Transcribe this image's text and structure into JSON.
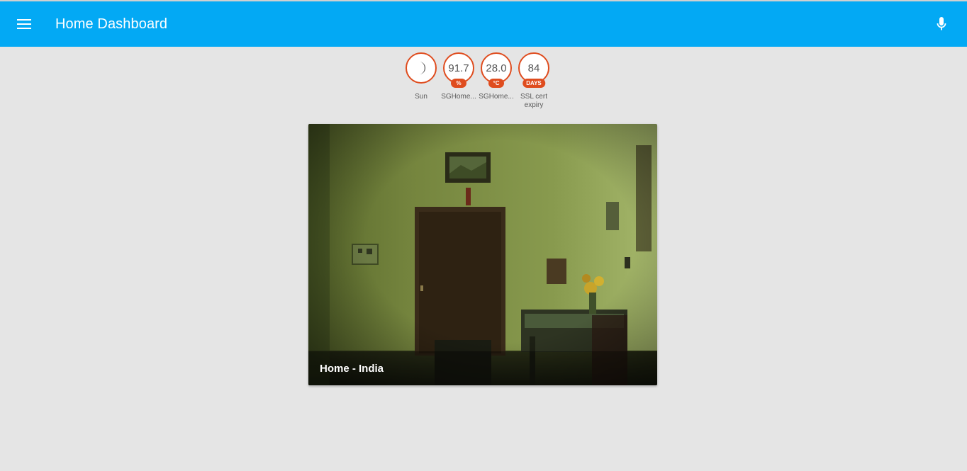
{
  "appbar": {
    "title": "Home Dashboard",
    "background": "#03a9f4",
    "menu_icon": "menu-icon",
    "mic_icon": "microphone-icon"
  },
  "badges": [
    {
      "name": "sun",
      "value": "",
      "icon": "moon-icon",
      "unit": "",
      "label": "Sun"
    },
    {
      "name": "humidity",
      "value": "91.7",
      "unit": "%",
      "label": "SGHome..."
    },
    {
      "name": "temperature",
      "value": "28.0",
      "unit": "°C",
      "label": "SGHome..."
    },
    {
      "name": "ssl-cert",
      "value": "84",
      "unit": "DAYS",
      "label": "SSL cert expiry"
    }
  ],
  "badge_color": "#df4c1e",
  "camera": {
    "caption": "Home - India"
  }
}
